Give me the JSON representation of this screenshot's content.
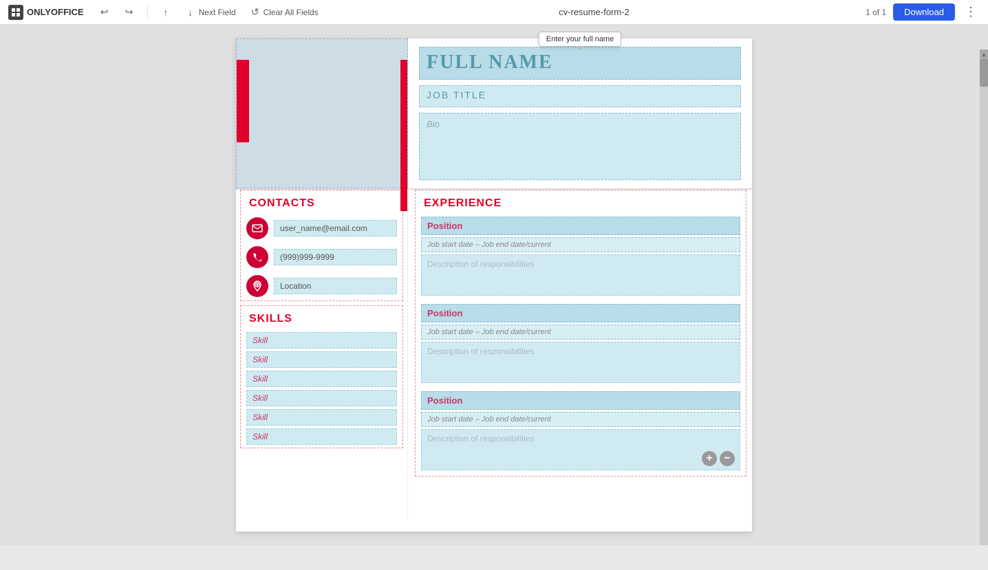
{
  "app": {
    "logo_text": "ONLYOFFICE",
    "document_title": "cv-resume-form-2",
    "page_count": "1 of 1"
  },
  "toolbar": {
    "undo_label": "Undo",
    "redo_label": "Redo",
    "prev_field_label": "Prev Field",
    "next_field_label": "Next Field",
    "clear_fields_label": "Clear All Fields",
    "download_label": "Download"
  },
  "tooltip": {
    "full_name": "Enter your full name"
  },
  "header": {
    "full_name_placeholder": "FULL NAME",
    "job_title_placeholder": "JOB TITLE",
    "bio_placeholder": "Bio"
  },
  "contacts": {
    "section_title": "CONTACTS",
    "email_placeholder": "user_name@email.com",
    "phone_placeholder": "(999)999-9999",
    "location_placeholder": "Location"
  },
  "skills": {
    "section_title": "SKILLS",
    "items": [
      "Skill",
      "Skill",
      "Skill",
      "Skill",
      "Skill",
      "Skill"
    ]
  },
  "experience": {
    "section_title": "EXPERIENCE",
    "entries": [
      {
        "position_placeholder": "Position",
        "date_placeholder": "Job start date – Job end date/current",
        "desc_placeholder": "Description of responsibilities",
        "show_controls": false
      },
      {
        "position_placeholder": "Position",
        "date_placeholder": "Job start date – Job end date/current",
        "desc_placeholder": "Description of responsibilities",
        "show_controls": false
      },
      {
        "position_placeholder": "Position",
        "date_placeholder": "Job start date – Job end date/current",
        "desc_placeholder": "Description of responsibilities",
        "show_controls": true
      }
    ]
  }
}
